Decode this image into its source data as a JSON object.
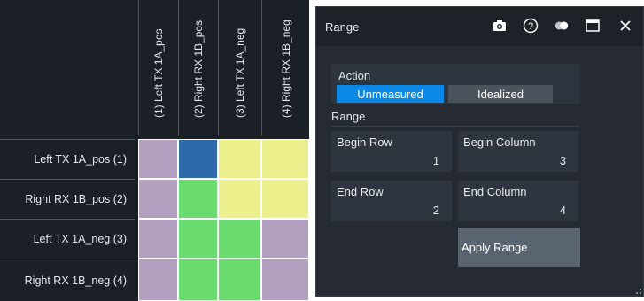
{
  "matrix": {
    "columns": [
      "(1)  Left TX 1A_pos",
      "(2)  Right RX 1B_pos",
      "(3)  Left TX 1A_neg",
      "(4)  Right RX 1B_neg"
    ],
    "rows": [
      "Left TX 1A_pos  (1)",
      "Right RX 1B_pos  (2)",
      "Left TX 1A_neg  (3)",
      "Right RX 1B_neg  (4)"
    ],
    "cell_colors": [
      [
        "#b3a0c1",
        "#2e6aab",
        "#ecf08c",
        "#ecf08c"
      ],
      [
        "#b3a0c1",
        "#69db6f",
        "#ecf08c",
        "#ecf08c"
      ],
      [
        "#b3a0c1",
        "#69db6f",
        "#69db6f",
        "#b3a0c1"
      ],
      [
        "#b3a0c1",
        "#69db6f",
        "#69db6f",
        "#b3a0c1"
      ]
    ]
  },
  "dialog": {
    "title": "Range",
    "icons": [
      "camera-icon",
      "help-icon",
      "toggle-icon",
      "maximize-icon",
      "close-icon"
    ],
    "action_label": "Action",
    "action_options": [
      "Unmeasured",
      "Idealized"
    ],
    "action_selected": "Unmeasured",
    "range_label": "Range",
    "begin_row_label": "Begin Row",
    "begin_row_value": "1",
    "begin_column_label": "Begin Column",
    "begin_column_value": "3",
    "end_row_label": "End Row",
    "end_row_value": "2",
    "end_column_label": "End Column",
    "end_column_value": "4",
    "apply_label": "Apply Range"
  },
  "colors": {
    "selected_tab": "#0a88e6",
    "unselected_tab": "#4a525c",
    "panel_dark": "#1b2027"
  }
}
